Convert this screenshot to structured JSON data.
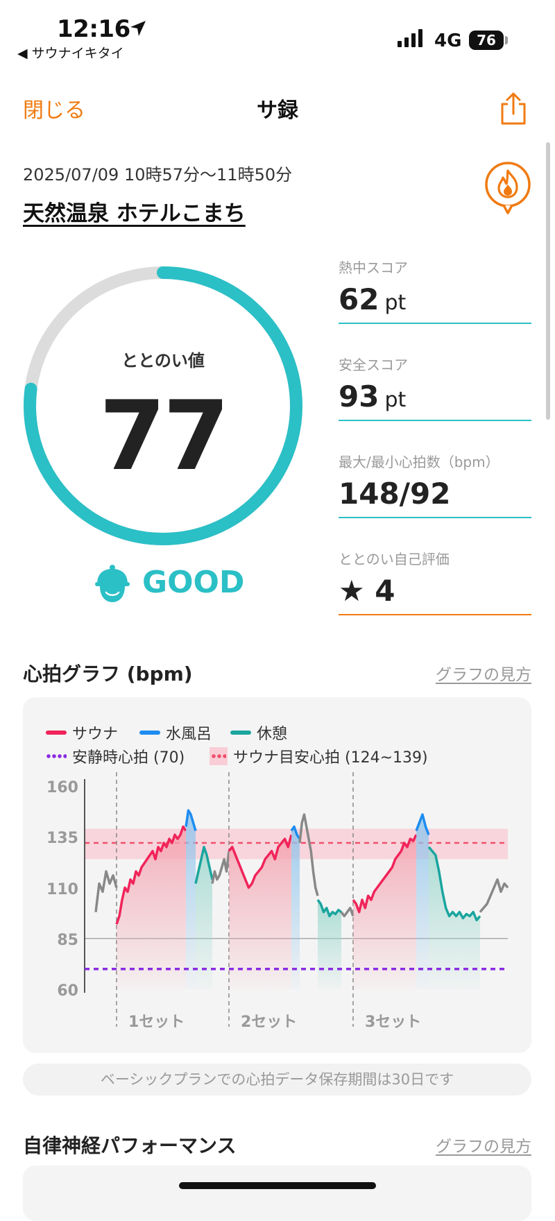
{
  "status_bar": {
    "time": "12:16",
    "back_app": "◀ サウナイキタイ",
    "network": "4G",
    "battery": "76"
  },
  "nav": {
    "close_label": "閉じる",
    "title": "サ録"
  },
  "session": {
    "datetime": "2025/07/09 10時57分〜11時50分",
    "facility": "天然温泉 ホテルこまち"
  },
  "ring": {
    "label": "ととのい値",
    "value": "77",
    "fill_fraction": 0.77,
    "rating": "GOOD"
  },
  "stats": [
    {
      "label": "熱中スコア",
      "value": "62",
      "unit": "pt",
      "line_color": "#2bbfc6"
    },
    {
      "label": "安全スコア",
      "value": "93",
      "unit": "pt",
      "line_color": "#2bbfc6"
    },
    {
      "label": "最大/最小心拍数（bpm）",
      "value": "148/92",
      "unit": "",
      "line_color": "#2bbfc6"
    },
    {
      "label": "ととのい自己評価",
      "value": "★ 4",
      "unit": "",
      "line_color": "#f07a10"
    }
  ],
  "heart_section": {
    "title": "心拍グラフ (bpm)",
    "link": "グラフの見方"
  },
  "legend": {
    "sauna": "サウナ",
    "cold_bath": "水風呂",
    "rest": "休憩",
    "resting_hr": "安静時心拍 (70)",
    "sauna_target": "サウナ目安心拍 (124~139)"
  },
  "colors": {
    "accent": "#f07a10",
    "teal": "#2bbfc6",
    "sauna": "#f0245a",
    "cold_bath": "#1e8cf0",
    "rest": "#1aa59e",
    "resting_line": "#8a2be2"
  },
  "chart_data": {
    "type": "line",
    "ylim": [
      60,
      160
    ],
    "y_ticks": [
      "160",
      "135",
      "110",
      "85",
      "60"
    ],
    "sets": [
      "1セット",
      "2セット",
      "3セット"
    ],
    "resting_hr": 70,
    "target_band": [
      124,
      139
    ],
    "target_line": 132,
    "series": [
      {
        "name": "サウナ",
        "color": "#f0245a",
        "x": [
          0,
          1,
          2,
          3,
          4,
          5,
          6,
          7,
          8,
          9,
          10,
          11,
          12,
          13,
          14,
          15,
          16,
          17,
          18,
          19,
          20,
          21,
          22,
          23,
          24,
          25,
          26,
          27,
          28,
          29,
          30,
          31,
          32,
          33,
          34,
          35,
          36
        ],
        "y": [
          112,
          118,
          120,
          132,
          136,
          128,
          114,
          110,
          116,
          124,
          120,
          126,
          130,
          132,
          136,
          140,
          95,
          92,
          95,
          104,
          110,
          116,
          122,
          126,
          132,
          134,
          136,
          130,
          134,
          102,
          110,
          118,
          122,
          130,
          134,
          136,
          134
        ]
      },
      {
        "name": "水風呂",
        "color": "#1e8cf0",
        "y": [
          148,
          145,
          140,
          150,
          142,
          146,
          144,
          140
        ]
      },
      {
        "name": "休憩",
        "color": "#1aa59e",
        "y": [
          112,
          116,
          124,
          120,
          104,
          100,
          106,
          100,
          102,
          98,
          95,
          96,
          94,
          95,
          94,
          96
        ]
      }
    ]
  },
  "storage_note": "ベーシックプランでの心拍データ保存期間は30日です",
  "autonomic_section": {
    "title": "自律神経パフォーマンス",
    "link": "グラフの見方"
  }
}
